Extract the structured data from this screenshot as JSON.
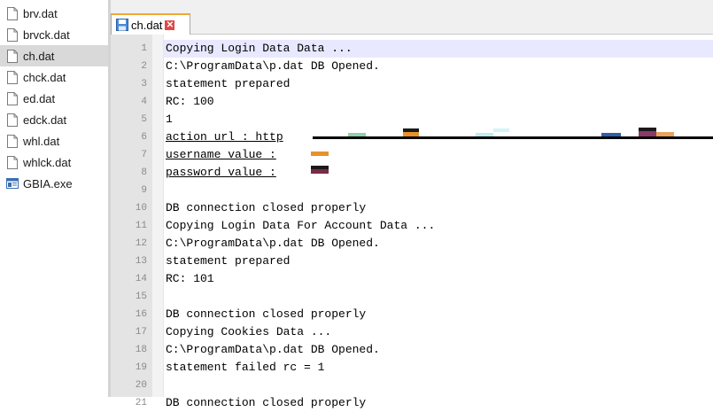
{
  "file_list": [
    {
      "name": "brv.dat",
      "icon": "file-icon"
    },
    {
      "name": "brvck.dat",
      "icon": "file-icon"
    },
    {
      "name": "ch.dat",
      "icon": "file-icon",
      "selected": true
    },
    {
      "name": "chck.dat",
      "icon": "file-icon"
    },
    {
      "name": "ed.dat",
      "icon": "file-icon"
    },
    {
      "name": "edck.dat",
      "icon": "file-icon"
    },
    {
      "name": "whl.dat",
      "icon": "file-icon"
    },
    {
      "name": "whlck.dat",
      "icon": "file-icon"
    },
    {
      "name": "GBIA.exe",
      "icon": "exe-icon"
    }
  ],
  "editor": {
    "tab_title": "ch.dat",
    "tab_close_glyph": "✕",
    "line_numbers": [
      "1",
      "2",
      "3",
      "4",
      "5",
      "6",
      "7",
      "8",
      "9",
      "10",
      "11",
      "12",
      "13",
      "14",
      "15",
      "16",
      "17",
      "18",
      "19",
      "20",
      "21"
    ],
    "lines": [
      "Copying Login Data Data ...",
      "C:\\ProgramData\\p.dat DB Opened.",
      "statement prepared",
      "RC: 100",
      "1",
      "action_url : http",
      "username_value :",
      "password_value :",
      "",
      "DB connection closed properly",
      "Copying Login Data For Account Data ...",
      "C:\\ProgramData\\p.dat DB Opened.",
      "statement prepared",
      "RC: 101",
      "",
      "DB connection closed properly",
      "Copying Cookies Data ...",
      "C:\\ProgramData\\p.dat DB Opened.",
      "statement failed rc = 1",
      "",
      "DB connection closed properly"
    ]
  },
  "colors": {
    "current_line": "#e8e8ff",
    "tab_accent": "#f0a830",
    "close_button": "#e04848"
  }
}
